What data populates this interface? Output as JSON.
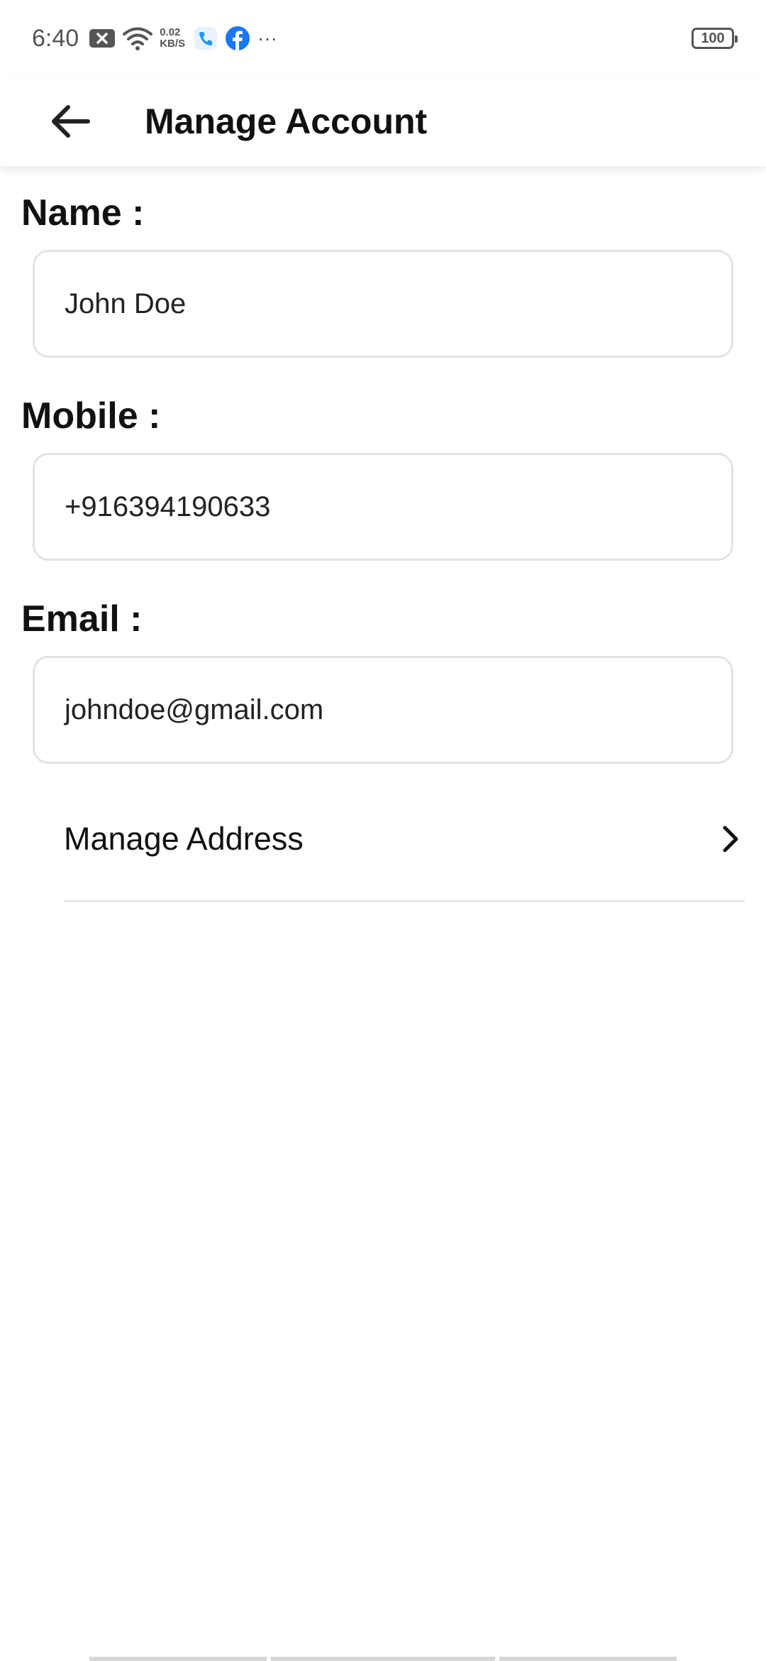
{
  "status_bar": {
    "time": "6:40",
    "net_speed_value": "0.02",
    "net_speed_unit": "KB/S",
    "more": "···",
    "battery": "100",
    "icons": [
      "notification-x-icon",
      "wifi-icon",
      "phone-call-icon",
      "facebook-icon"
    ],
    "facebook_color": "#1877f2",
    "phone_color": "#2196f3"
  },
  "app_bar": {
    "back_icon": "arrow-back-icon",
    "title": "Manage Account"
  },
  "form": {
    "name_label": "Name :",
    "name_value": "John Doe",
    "mobile_label": "Mobile :",
    "mobile_value": "+916394190633",
    "email_label": "Email :",
    "email_value": "johndoe@gmail.com"
  },
  "manage_address": {
    "label": "Manage Address",
    "icon": "chevron-right-icon"
  }
}
